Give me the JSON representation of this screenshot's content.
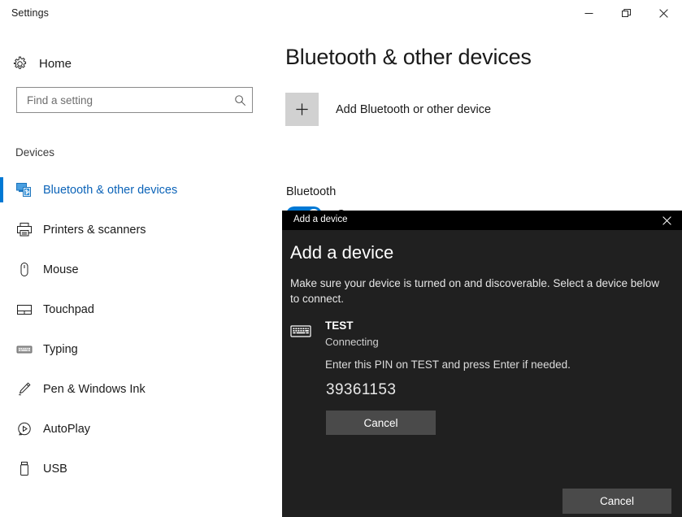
{
  "window": {
    "title": "Settings",
    "controls": [
      {
        "name": "minimize-button",
        "icon": "minimize-icon"
      },
      {
        "name": "restore-button",
        "icon": "restore-icon"
      },
      {
        "name": "close-button",
        "icon": "close-icon"
      }
    ]
  },
  "sidebar": {
    "home_label": "Home",
    "home_icon": "gear-icon",
    "search": {
      "value": "",
      "placeholder": "Find a setting",
      "icon": "search-icon"
    },
    "group_label": "Devices",
    "items": [
      {
        "label": "Bluetooth & other devices",
        "icon": "bluetooth-devices-icon",
        "selected": true
      },
      {
        "label": "Printers & scanners",
        "icon": "printer-icon",
        "selected": false
      },
      {
        "label": "Mouse",
        "icon": "mouse-icon",
        "selected": false
      },
      {
        "label": "Touchpad",
        "icon": "touchpad-icon",
        "selected": false
      },
      {
        "label": "Typing",
        "icon": "keyboard-icon",
        "selected": false
      },
      {
        "label": "Pen & Windows Ink",
        "icon": "pen-icon",
        "selected": false
      },
      {
        "label": "AutoPlay",
        "icon": "autoplay-icon",
        "selected": false
      },
      {
        "label": "USB",
        "icon": "usb-icon",
        "selected": false
      }
    ]
  },
  "main": {
    "page_title": "Bluetooth & other devices",
    "add_device_label": "Add Bluetooth or other device",
    "add_device_icon": "plus-icon",
    "bluetooth_section_label": "Bluetooth",
    "bluetooth_toggle_state": "On"
  },
  "dialog": {
    "titlebar_title": "Add a device",
    "close_icon": "close-icon",
    "heading": "Add a device",
    "subtitle": "Make sure your device is turned on and discoverable. Select a device below to connect.",
    "device": {
      "icon": "keyboard-icon",
      "name": "TEST",
      "status": "Connecting",
      "pin_instruction": "Enter this PIN on  TEST  and press Enter if needed.",
      "pin": "39361153",
      "cancel_label": "Cancel"
    },
    "bottom_cancel_label": "Cancel"
  },
  "colors": {
    "accent": "#0078d4",
    "selected_text": "#0b63b8",
    "dialog_bg": "#202020",
    "dialog_titlebar_bg": "#000000",
    "dialog_button_bg": "#4a4a4a",
    "tile_bg": "#d1d1d1"
  }
}
